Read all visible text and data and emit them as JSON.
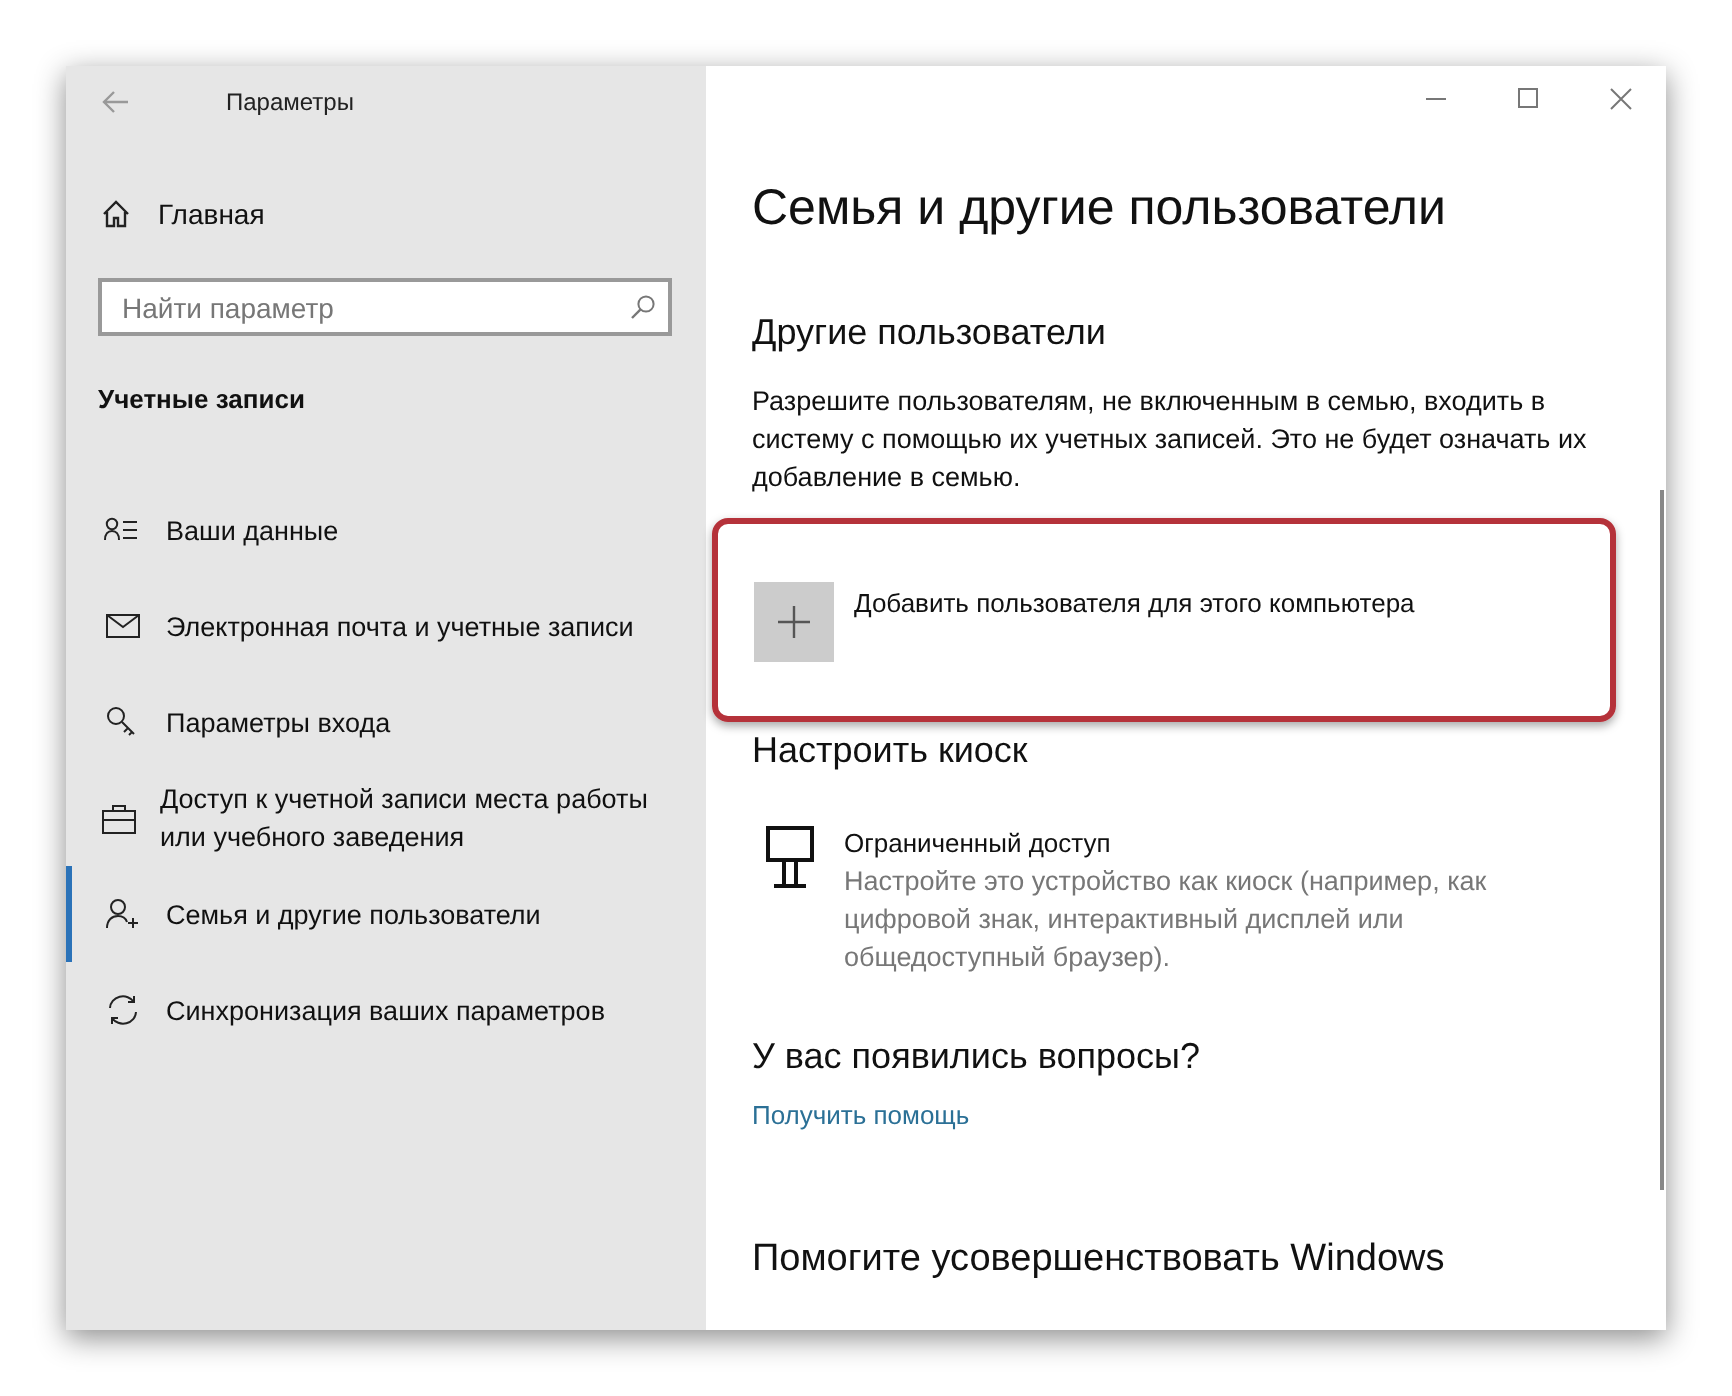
{
  "window": {
    "title": "Параметры"
  },
  "sidebar": {
    "home": "Главная",
    "search": {
      "placeholder": "Найти параметр"
    },
    "section": "Учетные записи",
    "items": [
      {
        "label": "Ваши данные",
        "selected": false
      },
      {
        "label": "Электронная почта и учетные записи",
        "selected": false
      },
      {
        "label": "Параметры входа",
        "selected": false
      },
      {
        "label": "Доступ к учетной записи места работы или учебного заведения",
        "selected": false
      },
      {
        "label": "Семья и другие пользователи",
        "selected": true
      },
      {
        "label": "Синхронизация ваших параметров",
        "selected": false
      }
    ]
  },
  "content": {
    "title": "Семья и другие пользователи",
    "other_users": {
      "heading": "Другие пользователи",
      "description": "Разрешите пользователям, не включенным в семью, входить в систему с помощью их учетных записей. Это не будет означать их добавление в семью.",
      "add_button": "Добавить пользователя для этого компьютера"
    },
    "kiosk": {
      "heading": "Настроить киоск",
      "item_title": "Ограниченный доступ",
      "item_description": "Настройте это устройство как киоск (например, как цифровой знак, интерактивный дисплей или общедоступный браузер)."
    },
    "questions": {
      "heading": "У вас появились вопросы?",
      "link": "Получить помощь"
    },
    "improve": {
      "heading": "Помогите усовершенствовать Windows"
    }
  }
}
